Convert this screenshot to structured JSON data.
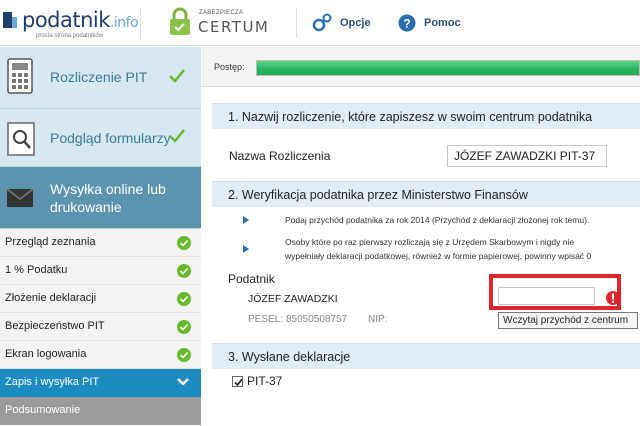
{
  "header": {
    "logo_text": "podatnik",
    "logo_ext": ".info",
    "logo_sub": "prosta strona podatników",
    "certum_small": "ZABEZPIECZA",
    "certum_big": "CERTUM",
    "opcje_label": "Opcje",
    "pomoc_label": "Pomoc"
  },
  "sidebar": {
    "steps": [
      {
        "label": "Rozliczenie PIT",
        "icon": "calculator-icon",
        "done": true
      },
      {
        "label": "Podgląd formularzy",
        "icon": "magnifier-icon",
        "done": true
      },
      {
        "label": "Wysyłka online lub drukowanie",
        "icon": "envelope-icon",
        "done": false
      }
    ],
    "items": [
      {
        "label": "Przegląd zeznania",
        "done": true
      },
      {
        "label": "1 % Podatku",
        "done": true
      },
      {
        "label": "Złożenie deklaracji",
        "done": true
      },
      {
        "label": "Bezpieczeństwo PIT",
        "done": true
      },
      {
        "label": "Ekran logowania",
        "done": true
      },
      {
        "label": "Zapis i wysyłka PIT",
        "active": true
      },
      {
        "label": "Podsumowanie"
      }
    ]
  },
  "progress": {
    "label": "Postęp:",
    "fraction": 1.0
  },
  "section1": {
    "title": "1. Nazwij rozliczenie, które zapiszesz w swoim centrum podatnika",
    "name_label": "Nazwa Rozliczenia",
    "name_value": "JÓZEF ZAWADZKI PIT-37"
  },
  "section2": {
    "title": "2. Weryfikacja podatnika przez Ministerstwo Finansów",
    "info1": "Podaj przychód podatnika za rok 2014 (Przychód z deklaracji złożonej rok temu).",
    "info2a": "Osoby które po raz pierwszy rozliczają się z Urzędem Skarbowym i nigdy nie",
    "info2b": "wypełniały deklaracji podatkowej, również w formie papierowej, powinny wpisać 0",
    "podatnik_label": "Podatnik",
    "podatnik_name": "JÓZEF ZAWADZKI",
    "pesel_label": "PESEL:",
    "pesel_value": "85050508757",
    "nip_label": "NIP:",
    "income_value": "",
    "tooltip": "Wczytaj przychód z centrum"
  },
  "section3": {
    "title": "3. Wysłane deklaracje",
    "pit_label": "PIT-37",
    "pit_checked": true
  },
  "colors": {
    "accent_blue": "#1c8cc0",
    "step_active": "#5b94ad",
    "check_green": "#67b82d",
    "error_red": "#e0262b"
  }
}
